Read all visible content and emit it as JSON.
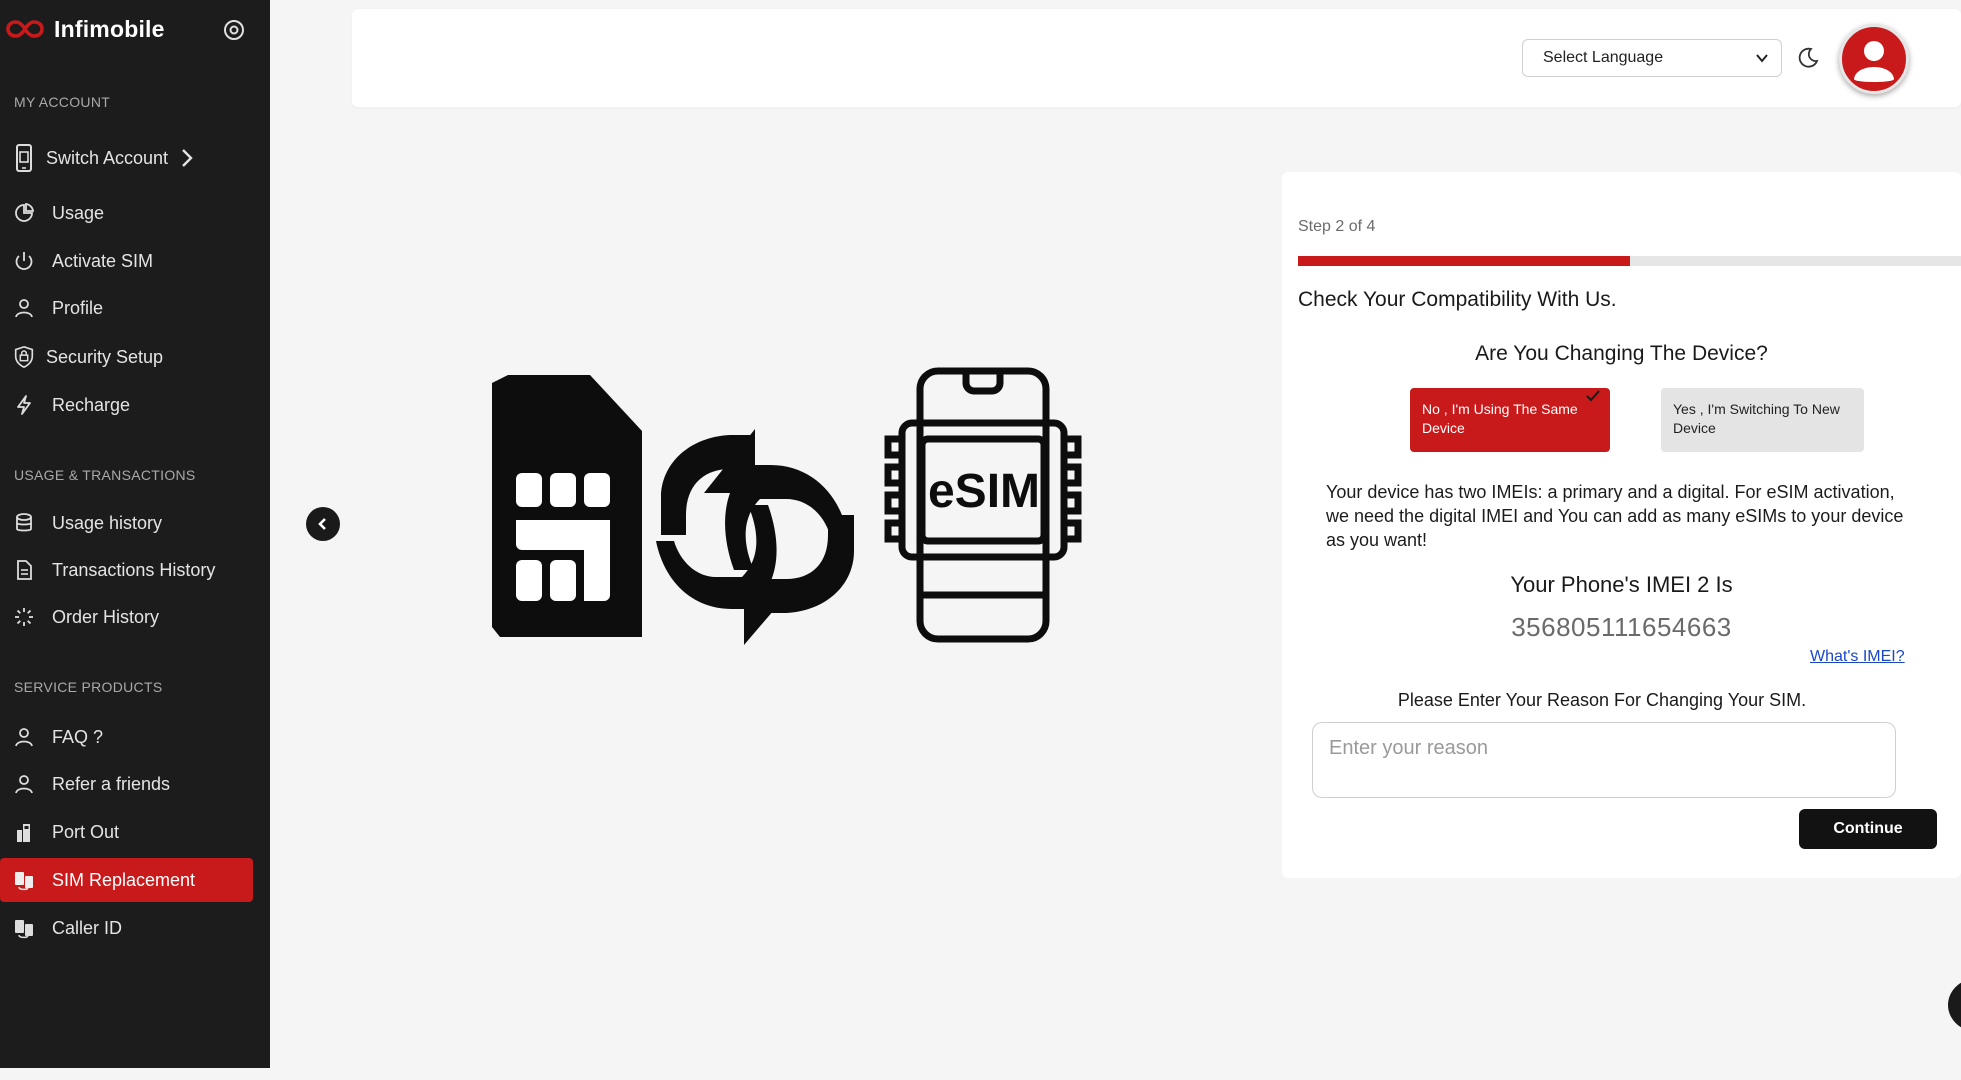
{
  "brand": {
    "name": "Infimobile",
    "accent": "#c8191b"
  },
  "sidebar": {
    "sections": [
      {
        "title": "MY ACCOUNT"
      },
      {
        "title": "USAGE & TRANSACTIONS"
      },
      {
        "title": "SERVICE PRODUCTS"
      }
    ],
    "items": [
      {
        "label": "Switch Account",
        "icon": "sim-phone-icon"
      },
      {
        "label": "Usage",
        "icon": "pie-chart-icon"
      },
      {
        "label": "Activate SIM",
        "icon": "power-icon"
      },
      {
        "label": "Profile",
        "icon": "user-icon"
      },
      {
        "label": "Security Setup",
        "icon": "shield-icon"
      },
      {
        "label": "Recharge",
        "icon": "bolt-icon"
      },
      {
        "label": "Usage history",
        "icon": "database-icon"
      },
      {
        "label": "Transactions History",
        "icon": "document-icon"
      },
      {
        "label": "Order History",
        "icon": "loader-icon"
      },
      {
        "label": "FAQ ?",
        "icon": "user-icon"
      },
      {
        "label": "Refer a friends",
        "icon": "user-icon"
      },
      {
        "label": "Port Out",
        "icon": "port-icon"
      },
      {
        "label": "SIM Replacement",
        "icon": "sim-swap-icon",
        "active": true
      },
      {
        "label": "Caller ID",
        "icon": "sim-swap-icon"
      }
    ]
  },
  "header": {
    "language": {
      "selected": "Select Language"
    }
  },
  "wizard": {
    "step_label": "Step 2 of 4",
    "progress": 0.5,
    "title": "Check Your Compatibility With Us.",
    "question": "Are You Changing The Device?",
    "option_no": "No , I'm Using The Same Device",
    "option_yes": "Yes , I'm Switching To New Device",
    "info": "Your device has two IMEIs: a primary and a digital. For eSIM activation, we need the digital IMEI and You can add as many eSIMs to your device as you want!",
    "imei_title": "Your Phone's IMEI 2 Is",
    "imei_value": "356805111654663",
    "imei_link": "What's IMEI?",
    "reason_label": "Please Enter Your Reason For Changing Your SIM.",
    "reason_placeholder": "Enter your reason",
    "continue_label": "Continue"
  },
  "illustration": {
    "esim_text": "eSIM"
  }
}
